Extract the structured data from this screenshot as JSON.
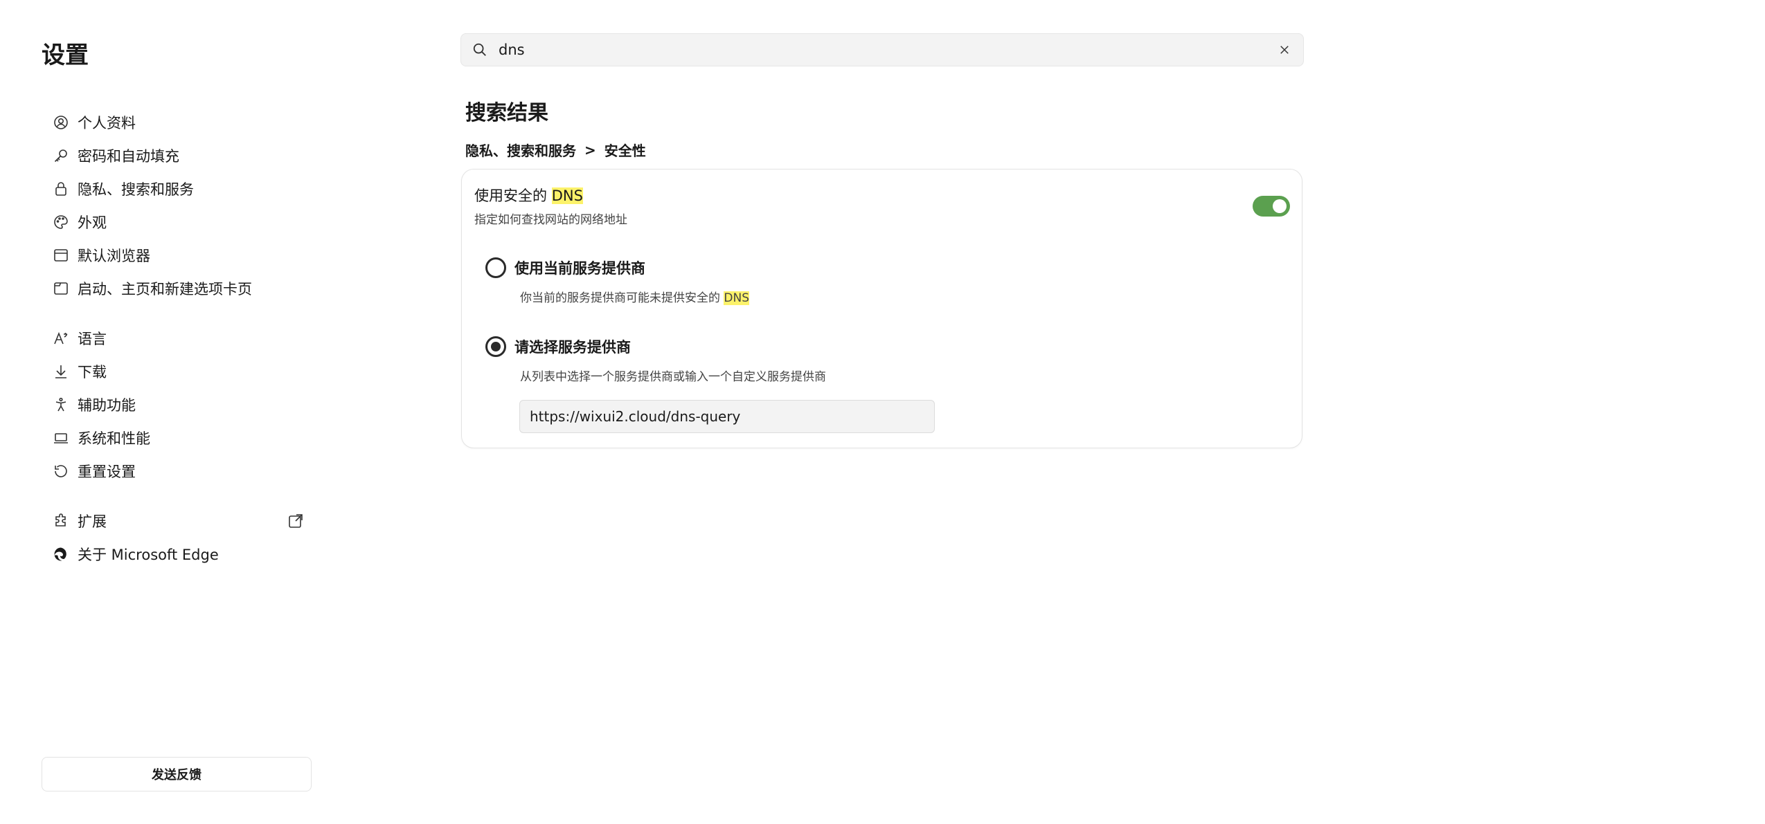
{
  "app": {
    "title": "设置"
  },
  "sidebar": {
    "items": [
      {
        "label": "个人资料",
        "icon": "profile-icon"
      },
      {
        "label": "密码和自动填充",
        "icon": "key-icon"
      },
      {
        "label": "隐私、搜索和服务",
        "icon": "lock-icon"
      },
      {
        "label": "外观",
        "icon": "palette-icon"
      },
      {
        "label": "默认浏览器",
        "icon": "browser-icon"
      },
      {
        "label": "启动、主页和新建选项卡页",
        "icon": "home-tab-icon"
      },
      {
        "label": "语言",
        "icon": "language-icon"
      },
      {
        "label": "下载",
        "icon": "download-icon"
      },
      {
        "label": "辅助功能",
        "icon": "accessibility-icon"
      },
      {
        "label": "系统和性能",
        "icon": "laptop-icon"
      },
      {
        "label": "重置设置",
        "icon": "reset-icon"
      },
      {
        "label": "扩展",
        "icon": "puzzle-icon"
      },
      {
        "label": "关于 Microsoft Edge",
        "icon": "edge-icon"
      }
    ],
    "feedback_label": "发送反馈"
  },
  "search": {
    "value": "dns"
  },
  "results": {
    "title": "搜索结果",
    "breadcrumb": {
      "parent": "隐私、搜索和服务",
      "separator": ">",
      "current": "安全性"
    }
  },
  "setting": {
    "title_prefix": "使用安全的 ",
    "title_highlight": "DNS",
    "description": "指定如何查找网站的网络地址",
    "enabled": true,
    "options": [
      {
        "label": "使用当前服务提供商",
        "desc_prefix": "你当前的服务提供商可能未提供安全的 ",
        "desc_highlight": "DNS",
        "selected": false
      },
      {
        "label": "请选择服务提供商",
        "desc": "从列表中选择一个服务提供商或输入一个自定义服务提供商",
        "selected": true
      }
    ],
    "custom_provider_value": "https://wixui2.cloud/dns-query"
  },
  "colors": {
    "toggle_on": "#5ba04f",
    "highlight": "#fcf26a"
  }
}
